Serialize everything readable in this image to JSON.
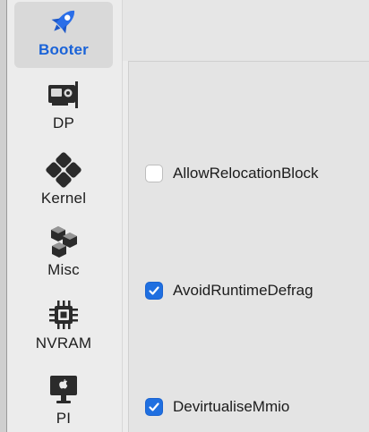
{
  "sidebar": {
    "items": [
      {
        "label": "Booter",
        "icon": "rocket-icon",
        "selected": true
      },
      {
        "label": "DP",
        "icon": "graphics-card-icon",
        "selected": false
      },
      {
        "label": "Kernel",
        "icon": "kernel-icon",
        "selected": false
      },
      {
        "label": "Misc",
        "icon": "cubes-icon",
        "selected": false
      },
      {
        "label": "NVRAM",
        "icon": "chip-icon",
        "selected": false
      },
      {
        "label": "PI",
        "icon": "monitor-apple-icon",
        "selected": false
      }
    ]
  },
  "options": [
    {
      "label": "AllowRelocationBlock",
      "checked": false
    },
    {
      "label": "AvoidRuntimeDefrag",
      "checked": true
    },
    {
      "label": "DevirtualiseMmio",
      "checked": true
    }
  ],
  "colors": {
    "accent": "#1f6fe0",
    "selected_label": "#1a63d8",
    "background": "#ececec"
  }
}
